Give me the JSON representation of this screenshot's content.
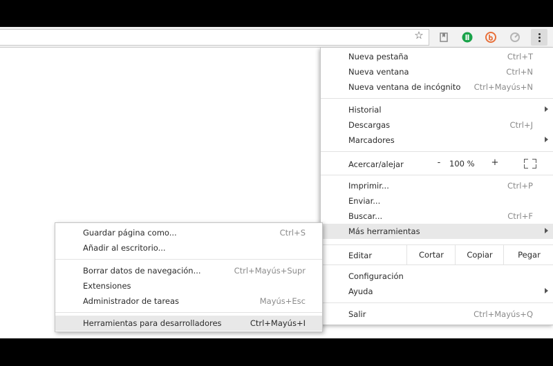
{
  "toolbar": {
    "icons": [
      "star-icon",
      "bookmark-extension-icon",
      "green-extension-icon",
      "orange-extension-icon",
      "gray-extension-icon",
      "kebab-menu-icon"
    ],
    "colors": {
      "green": "#1aa34a",
      "orange": "#e8703a",
      "gray": "#b5b5b5"
    }
  },
  "menu": {
    "group1": [
      {
        "label": "Nueva pestaña",
        "shortcut": "Ctrl+T"
      },
      {
        "label": "Nueva ventana",
        "shortcut": "Ctrl+N"
      },
      {
        "label": "Nueva ventana de incógnito",
        "shortcut": "Ctrl+Mayús+N"
      }
    ],
    "group2": [
      {
        "label": "Historial",
        "shortcut": ""
      },
      {
        "label": "Descargas",
        "shortcut": "Ctrl+J"
      },
      {
        "label": "Marcadores",
        "shortcut": ""
      }
    ],
    "zoom": {
      "label": "Acercar/alejar",
      "minus": "-",
      "value": "100 %",
      "plus": "+"
    },
    "group3": [
      {
        "label": "Imprimir...",
        "shortcut": "Ctrl+P"
      },
      {
        "label": "Enviar...",
        "shortcut": ""
      },
      {
        "label": "Buscar...",
        "shortcut": "Ctrl+F"
      },
      {
        "label": "Más herramientas",
        "shortcut": ""
      }
    ],
    "edit": {
      "label": "Editar",
      "cut": "Cortar",
      "copy": "Copiar",
      "paste": "Pegar"
    },
    "group4": [
      {
        "label": "Configuración",
        "shortcut": ""
      },
      {
        "label": "Ayuda",
        "shortcut": ""
      }
    ],
    "exit": {
      "label": "Salir",
      "shortcut": "Ctrl+Mayús+Q"
    }
  },
  "submenu": {
    "group1": [
      {
        "label": "Guardar página como...",
        "shortcut": "Ctrl+S"
      },
      {
        "label": "Añadir al escritorio...",
        "shortcut": ""
      }
    ],
    "group2": [
      {
        "label": "Borrar datos de navegación...",
        "shortcut": "Ctrl+Mayús+Supr"
      },
      {
        "label": "Extensiones",
        "shortcut": ""
      },
      {
        "label": "Administrador de tareas",
        "shortcut": "Mayús+Esc"
      }
    ],
    "group3": [
      {
        "label": "Herramientas para desarrolladores",
        "shortcut": "Ctrl+Mayús+I"
      }
    ]
  }
}
